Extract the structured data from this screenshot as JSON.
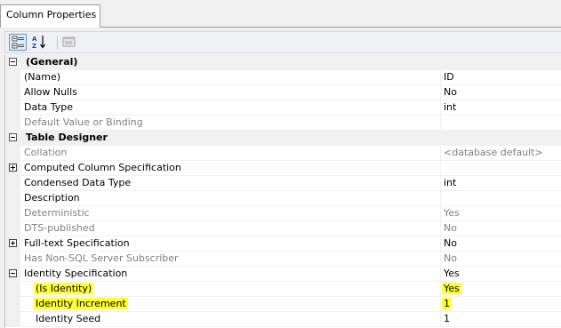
{
  "window": {
    "tab_label": "Column Properties"
  },
  "toolbar": {
    "buttons": [
      {
        "name": "categorized",
        "icon": "categorized-icon",
        "active": true
      },
      {
        "name": "alphabetical",
        "icon": "sort-az-icon",
        "active": false
      },
      {
        "name": "property-pages",
        "icon": "property-pages-icon",
        "active": false
      }
    ]
  },
  "properties": {
    "general": {
      "label": "(General)",
      "name_label": "(Name)",
      "name_value": "ID",
      "allow_nulls_label": "Allow Nulls",
      "allow_nulls_value": "No",
      "data_type_label": "Data Type",
      "data_type_value": "int",
      "default_label": "Default Value or Binding",
      "default_value": ""
    },
    "table_designer": {
      "label": "Table Designer",
      "collation_label": "Collation",
      "collation_value": "<database default>",
      "computed_label": "Computed Column Specification",
      "computed_value": "",
      "condensed_label": "Condensed Data Type",
      "condensed_value": "int",
      "description_label": "Description",
      "description_value": "",
      "deterministic_label": "Deterministic",
      "deterministic_value": "Yes",
      "dts_label": "DTS-published",
      "dts_value": "No",
      "fulltext_label": "Full-text Specification",
      "fulltext_value": "No",
      "nonsql_label": "Has Non-SQL Server Subscriber",
      "nonsql_value": "No",
      "identity_spec_label": "Identity Specification",
      "identity_spec_value": "Yes",
      "is_identity_label": "(Is Identity)",
      "is_identity_value": "Yes",
      "increment_label": "Identity Increment",
      "increment_value": "1",
      "seed_label": "Identity Seed",
      "seed_value": "1"
    }
  },
  "colors": {
    "highlight": "#ffff33",
    "disabled_text": "#808080",
    "category_bg": "#f0f0f0"
  }
}
